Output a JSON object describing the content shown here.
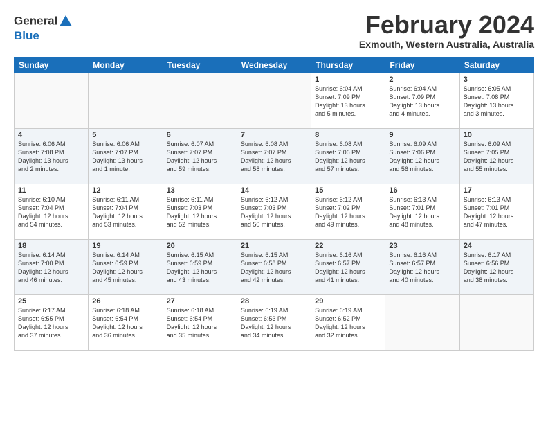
{
  "header": {
    "logo_line1": "General",
    "logo_line2": "Blue",
    "title": "February 2024",
    "location": "Exmouth, Western Australia, Australia"
  },
  "days_of_week": [
    "Sunday",
    "Monday",
    "Tuesday",
    "Wednesday",
    "Thursday",
    "Friday",
    "Saturday"
  ],
  "weeks": [
    [
      {
        "day": "",
        "info": ""
      },
      {
        "day": "",
        "info": ""
      },
      {
        "day": "",
        "info": ""
      },
      {
        "day": "",
        "info": ""
      },
      {
        "day": "1",
        "info": "Sunrise: 6:04 AM\nSunset: 7:09 PM\nDaylight: 13 hours\nand 5 minutes."
      },
      {
        "day": "2",
        "info": "Sunrise: 6:04 AM\nSunset: 7:09 PM\nDaylight: 13 hours\nand 4 minutes."
      },
      {
        "day": "3",
        "info": "Sunrise: 6:05 AM\nSunset: 7:08 PM\nDaylight: 13 hours\nand 3 minutes."
      }
    ],
    [
      {
        "day": "4",
        "info": "Sunrise: 6:06 AM\nSunset: 7:08 PM\nDaylight: 13 hours\nand 2 minutes."
      },
      {
        "day": "5",
        "info": "Sunrise: 6:06 AM\nSunset: 7:07 PM\nDaylight: 13 hours\nand 1 minute."
      },
      {
        "day": "6",
        "info": "Sunrise: 6:07 AM\nSunset: 7:07 PM\nDaylight: 12 hours\nand 59 minutes."
      },
      {
        "day": "7",
        "info": "Sunrise: 6:08 AM\nSunset: 7:07 PM\nDaylight: 12 hours\nand 58 minutes."
      },
      {
        "day": "8",
        "info": "Sunrise: 6:08 AM\nSunset: 7:06 PM\nDaylight: 12 hours\nand 57 minutes."
      },
      {
        "day": "9",
        "info": "Sunrise: 6:09 AM\nSunset: 7:06 PM\nDaylight: 12 hours\nand 56 minutes."
      },
      {
        "day": "10",
        "info": "Sunrise: 6:09 AM\nSunset: 7:05 PM\nDaylight: 12 hours\nand 55 minutes."
      }
    ],
    [
      {
        "day": "11",
        "info": "Sunrise: 6:10 AM\nSunset: 7:04 PM\nDaylight: 12 hours\nand 54 minutes."
      },
      {
        "day": "12",
        "info": "Sunrise: 6:11 AM\nSunset: 7:04 PM\nDaylight: 12 hours\nand 53 minutes."
      },
      {
        "day": "13",
        "info": "Sunrise: 6:11 AM\nSunset: 7:03 PM\nDaylight: 12 hours\nand 52 minutes."
      },
      {
        "day": "14",
        "info": "Sunrise: 6:12 AM\nSunset: 7:03 PM\nDaylight: 12 hours\nand 50 minutes."
      },
      {
        "day": "15",
        "info": "Sunrise: 6:12 AM\nSunset: 7:02 PM\nDaylight: 12 hours\nand 49 minutes."
      },
      {
        "day": "16",
        "info": "Sunrise: 6:13 AM\nSunset: 7:01 PM\nDaylight: 12 hours\nand 48 minutes."
      },
      {
        "day": "17",
        "info": "Sunrise: 6:13 AM\nSunset: 7:01 PM\nDaylight: 12 hours\nand 47 minutes."
      }
    ],
    [
      {
        "day": "18",
        "info": "Sunrise: 6:14 AM\nSunset: 7:00 PM\nDaylight: 12 hours\nand 46 minutes."
      },
      {
        "day": "19",
        "info": "Sunrise: 6:14 AM\nSunset: 6:59 PM\nDaylight: 12 hours\nand 45 minutes."
      },
      {
        "day": "20",
        "info": "Sunrise: 6:15 AM\nSunset: 6:59 PM\nDaylight: 12 hours\nand 43 minutes."
      },
      {
        "day": "21",
        "info": "Sunrise: 6:15 AM\nSunset: 6:58 PM\nDaylight: 12 hours\nand 42 minutes."
      },
      {
        "day": "22",
        "info": "Sunrise: 6:16 AM\nSunset: 6:57 PM\nDaylight: 12 hours\nand 41 minutes."
      },
      {
        "day": "23",
        "info": "Sunrise: 6:16 AM\nSunset: 6:57 PM\nDaylight: 12 hours\nand 40 minutes."
      },
      {
        "day": "24",
        "info": "Sunrise: 6:17 AM\nSunset: 6:56 PM\nDaylight: 12 hours\nand 38 minutes."
      }
    ],
    [
      {
        "day": "25",
        "info": "Sunrise: 6:17 AM\nSunset: 6:55 PM\nDaylight: 12 hours\nand 37 minutes."
      },
      {
        "day": "26",
        "info": "Sunrise: 6:18 AM\nSunset: 6:54 PM\nDaylight: 12 hours\nand 36 minutes."
      },
      {
        "day": "27",
        "info": "Sunrise: 6:18 AM\nSunset: 6:54 PM\nDaylight: 12 hours\nand 35 minutes."
      },
      {
        "day": "28",
        "info": "Sunrise: 6:19 AM\nSunset: 6:53 PM\nDaylight: 12 hours\nand 34 minutes."
      },
      {
        "day": "29",
        "info": "Sunrise: 6:19 AM\nSunset: 6:52 PM\nDaylight: 12 hours\nand 32 minutes."
      },
      {
        "day": "",
        "info": ""
      },
      {
        "day": "",
        "info": ""
      }
    ]
  ]
}
